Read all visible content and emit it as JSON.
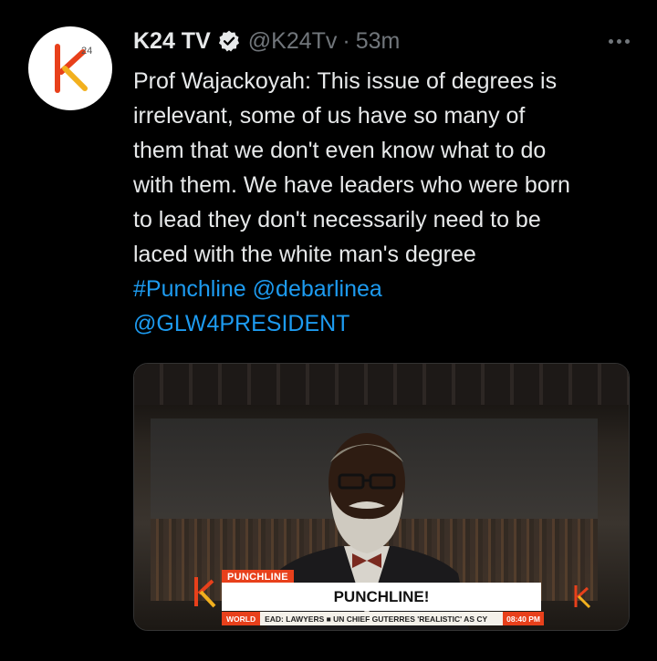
{
  "account": {
    "name": "K24 TV",
    "handle": "@K24Tv",
    "separator": "·",
    "time": "53m"
  },
  "tweet": {
    "lines": [
      "Prof Wajackoyah: This issue of degrees is",
      "irrelevant, some of us have so many of",
      "them that we don't even know what to do",
      "with them. We have leaders who were born",
      "to lead they don't necessarily need to be",
      "laced with the white man's degree"
    ],
    "hashtag": "#Punchline",
    "mention1": "@debarlinea",
    "mention2": "@GLW4PRESIDENT"
  },
  "media": {
    "tag": "PUNCHLINE",
    "headline": "PUNCHLINE!",
    "ticker_label": "WORLD",
    "ticker_text": "EAD: LAWYERS ■ UN CHIEF GUTERRES 'REALISTIC' AS CY",
    "ticker_time": "08:40 PM"
  },
  "logo_text": "k24",
  "colors": {
    "link": "#1d9bf0",
    "muted": "#71767b",
    "brand": "#e8401b"
  }
}
